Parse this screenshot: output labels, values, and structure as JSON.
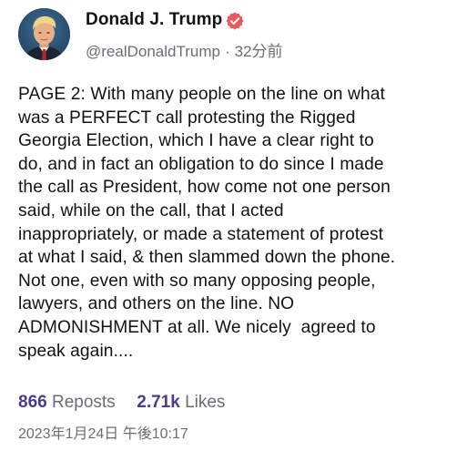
{
  "post": {
    "author": {
      "display_name": "Donald J. Trump",
      "handle": "@realDonaldTrump",
      "separator": "·",
      "relative_time": "32分前",
      "verified_color": "#e9585b"
    },
    "body_lines": [
      "PAGE 2: With many people on the line on what",
      "was a PERFECT call protesting the Rigged",
      "Georgia Election, which I have a clear right to",
      "do, and in fact an obligation to do since I made",
      "the call as President, how come not one person",
      "said, while on the call, that I acted",
      "inappropriately, or made a statement of protest",
      "at what I said, & then slammed down the phone.",
      "Not one, even with so many opposing people,",
      "lawyers, and others on the line. NO",
      "ADMONISHMENT at all. We nicely  agreed to",
      "speak again...."
    ],
    "stats": {
      "reposts_count": "866",
      "reposts_label": "Reposts",
      "likes_count": "2.71k",
      "likes_label": "Likes"
    },
    "timestamp": "2023年1月24日 午後10:17"
  }
}
